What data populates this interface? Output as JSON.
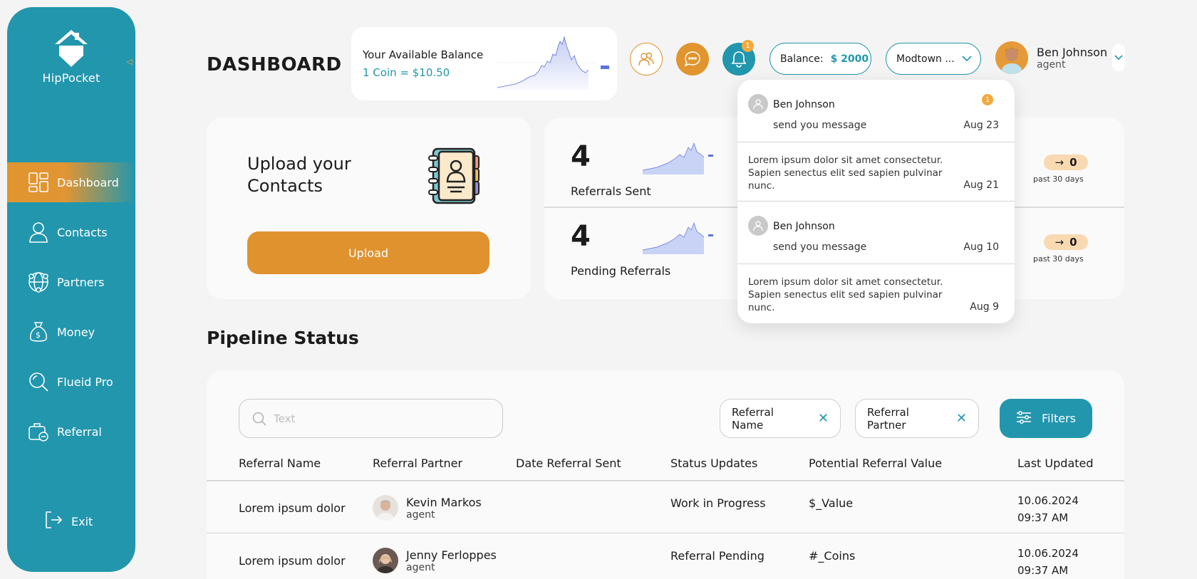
{
  "sidebar": {
    "brand": "HipPocket",
    "items": [
      {
        "label": "Dashboard",
        "icon": "dashboard-icon",
        "active": true
      },
      {
        "label": "Contacts",
        "icon": "user-icon"
      },
      {
        "label": "Partners",
        "icon": "globe-network-icon"
      },
      {
        "label": "Money",
        "icon": "money-bag-icon"
      },
      {
        "label": "Flueid Pro",
        "icon": "magnifier-icon"
      },
      {
        "label": "Referral",
        "icon": "briefcase-link-icon"
      }
    ],
    "exit_label": "Exit"
  },
  "header": {
    "title": "DASHBOARD",
    "balance_card": {
      "label": "Your Available Balance",
      "rate": "1 Coin = $10.50"
    },
    "notification_count": "1",
    "balance_pill": {
      "label": "Balance:",
      "amount": "$ 2000"
    },
    "location": "Modtown ...",
    "user": {
      "name": "Ben Johnson",
      "role": "agent"
    }
  },
  "upload_card": {
    "title": "Upload your Contacts",
    "button": "Upload"
  },
  "stats": [
    {
      "value": "4",
      "label": "Referrals Sent",
      "change": "0",
      "change_period": "past 30 days"
    },
    {
      "value": "4",
      "label": "Pending Referrals",
      "change": "0",
      "change_period": "past 30 days"
    }
  ],
  "notifications": [
    {
      "type": "message",
      "name": "Ben Johnson",
      "text": "send you message",
      "date": "Aug 23",
      "badge": "1"
    },
    {
      "type": "text",
      "text": "Lorem ipsum dolor sit amet consectetur. Sapien senectus elit sed sapien pulvinar nunc.",
      "date": "Aug 21"
    },
    {
      "type": "message",
      "name": "Ben Johnson",
      "text": "send you message",
      "date": "Aug 10"
    },
    {
      "type": "text",
      "text": "Lorem ipsum dolor sit amet consectetur. Sapien senectus elit sed sapien pulvinar nunc.",
      "date": "Aug 9"
    }
  ],
  "pipeline": {
    "title": "Pipeline Status",
    "search_placeholder": "Text",
    "chips": [
      "Referral Name",
      "Referral Partner"
    ],
    "filters_label": "Filters",
    "columns": [
      "Referral Name",
      "Referral Partner",
      "Date Referral Sent",
      "Status Updates",
      "Potential Referral Value",
      "Last Updated"
    ],
    "rows": [
      {
        "name": "Lorem ipsum dolor",
        "partner": "Kevin Markos",
        "partner_role": "agent",
        "date_sent": "",
        "status": "Work in Progress",
        "value": "$_Value",
        "updated_date": "10.06.2024",
        "updated_time": "09:37 AM"
      },
      {
        "name": "Lorem ipsum dolor",
        "partner": "Jenny Ferloppes",
        "partner_role": "agent",
        "date_sent": "",
        "status": "Referral Pending",
        "value": "#_Coins",
        "updated_date": "10.06.2024",
        "updated_time": "09:37 AM"
      }
    ]
  },
  "colors": {
    "teal": "#2296ad",
    "orange": "#e0952f",
    "badge": "#f3a93d"
  }
}
